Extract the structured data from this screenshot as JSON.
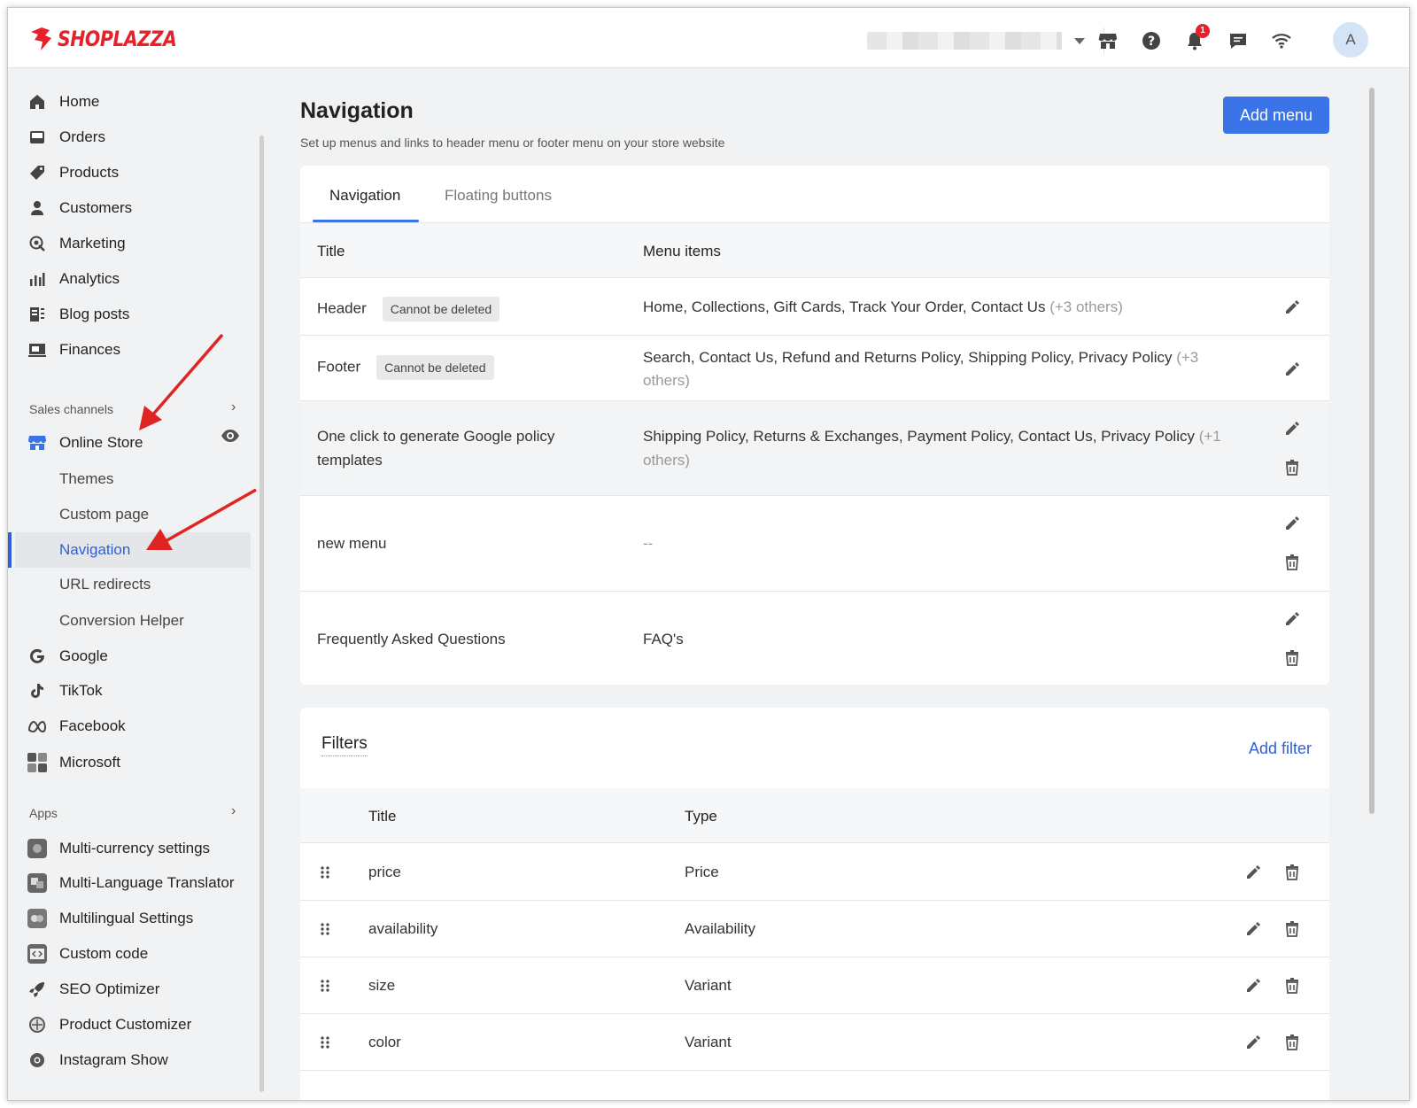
{
  "brand": {
    "name": "SHOPLAZZA",
    "color": "#e8202a"
  },
  "topbar": {
    "icons": [
      "store-icon",
      "help-icon",
      "bell-icon",
      "chat-icon",
      "wifi-icon"
    ],
    "notification_count": "1",
    "avatar_initial": "A"
  },
  "sidebar": {
    "main_items": [
      {
        "label": "Home",
        "icon": "home-icon"
      },
      {
        "label": "Orders",
        "icon": "orders-icon"
      },
      {
        "label": "Products",
        "icon": "tag-icon"
      },
      {
        "label": "Customers",
        "icon": "person-icon"
      },
      {
        "label": "Marketing",
        "icon": "marketing-icon"
      },
      {
        "label": "Analytics",
        "icon": "bar-chart-icon"
      },
      {
        "label": "Blog posts",
        "icon": "blog-icon"
      },
      {
        "label": "Finances",
        "icon": "finance-icon"
      }
    ],
    "sales_channels_label": "Sales channels",
    "online_store_label": "Online Store",
    "online_store_sub": [
      {
        "label": "Themes"
      },
      {
        "label": "Custom page"
      },
      {
        "label": "Navigation",
        "active": true
      },
      {
        "label": "URL redirects"
      },
      {
        "label": "Conversion Helper"
      }
    ],
    "channels": [
      {
        "label": "Google",
        "icon": "google-icon"
      },
      {
        "label": "TikTok",
        "icon": "tiktok-icon"
      },
      {
        "label": "Facebook",
        "icon": "meta-icon"
      },
      {
        "label": "Microsoft",
        "icon": "microsoft-icon"
      }
    ],
    "apps_label": "Apps",
    "apps": [
      {
        "label": "Multi-currency settings",
        "icon": "currency-app-icon"
      },
      {
        "label": "Multi-Language Translator",
        "icon": "translator-app-icon"
      },
      {
        "label": "Multilingual Settings",
        "icon": "multilingual-app-icon"
      },
      {
        "label": "Custom code",
        "icon": "code-app-icon"
      },
      {
        "label": "SEO Optimizer",
        "icon": "rocket-icon"
      },
      {
        "label": "Product Customizer",
        "icon": "customizer-app-icon"
      },
      {
        "label": "Instagram Show",
        "icon": "instagram-icon"
      }
    ]
  },
  "page": {
    "title": "Navigation",
    "subtitle": "Set up menus and links to header menu or footer menu on your store website",
    "add_menu_label": "Add menu",
    "accent": "#3b73e8"
  },
  "tabs": [
    {
      "label": "Navigation",
      "active": true
    },
    {
      "label": "Floating buttons",
      "active": false
    }
  ],
  "menus_table": {
    "headers": {
      "title": "Title",
      "items": "Menu items"
    },
    "rows": [
      {
        "title": "Header",
        "tag": "Cannot be deleted",
        "items": "Home, Collections, Gift Cards, Track Your Order, Contact Us",
        "extra": "(+3 others)",
        "deletable": false
      },
      {
        "title": "Footer",
        "tag": "Cannot be deleted",
        "items": "Search, Contact Us, Refund and Returns Policy, Shipping Policy, Privacy Policy",
        "extra": "(+3 others)",
        "deletable": false
      },
      {
        "title": "One click to generate Google policy templates",
        "tag": "",
        "items": "Shipping Policy, Returns & Exchanges, Payment Policy, Contact Us, Privacy Policy",
        "extra": "(+1 others)",
        "deletable": true
      },
      {
        "title": "new menu",
        "tag": "",
        "items": "--",
        "extra": "",
        "deletable": true
      },
      {
        "title": "Frequently Asked Questions",
        "tag": "",
        "items": "FAQ's",
        "extra": "",
        "deletable": true
      }
    ]
  },
  "filters": {
    "title": "Filters",
    "add_label": "Add filter",
    "headers": {
      "title": "Title",
      "type": "Type"
    },
    "rows": [
      {
        "title": "price",
        "type": "Price"
      },
      {
        "title": "availability",
        "type": "Availability"
      },
      {
        "title": "size",
        "type": "Variant"
      },
      {
        "title": "color",
        "type": "Variant"
      }
    ]
  }
}
